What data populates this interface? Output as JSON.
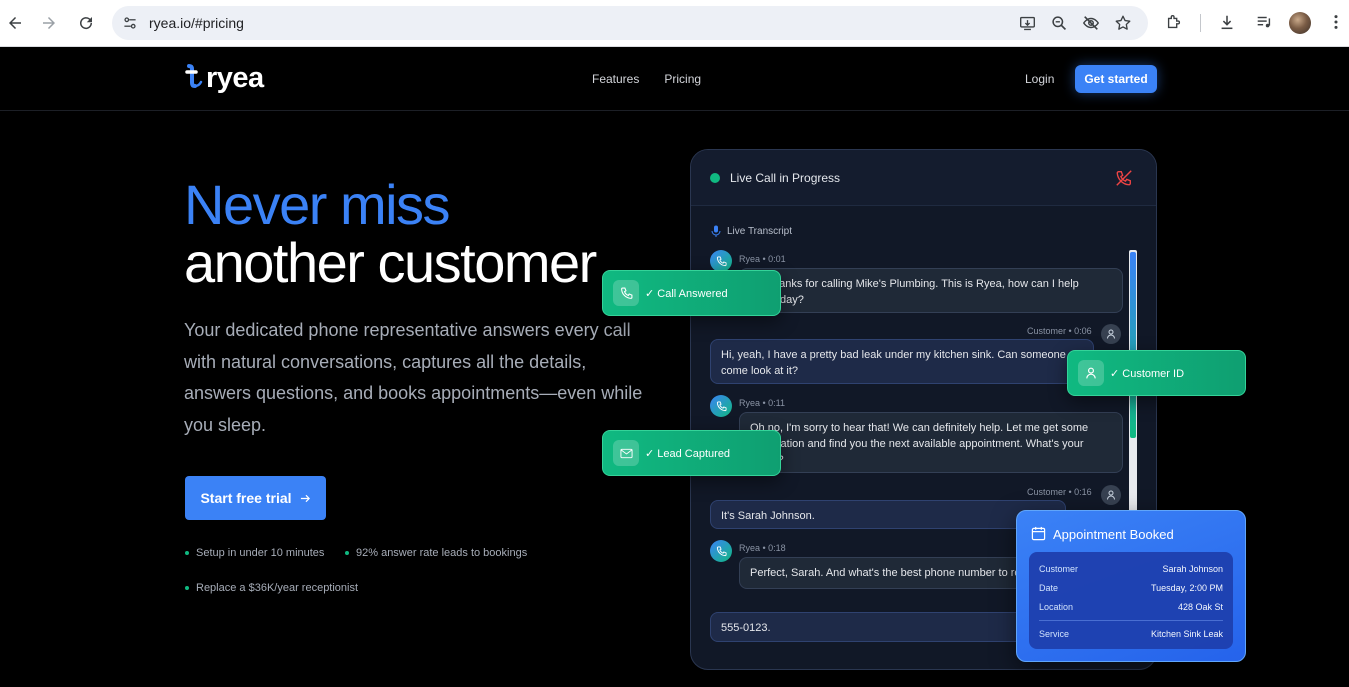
{
  "browser": {
    "url": "ryea.io/#pricing"
  },
  "site": {
    "logo": "ryea",
    "nav": [
      "Features",
      "Pricing"
    ],
    "login": "Login",
    "get_started": "Get started"
  },
  "hero": {
    "headline_line1": "Never miss",
    "headline_line2": "another customer",
    "subtext": "Your dedicated phone representative answers every call with natural conversations, captures all the details, answers questions, and books appointments—even while you sleep.",
    "cta": "Start free trial",
    "bullets": [
      "Setup in under 10 minutes",
      "92% answer rate leads to bookings",
      "Replace a $36K/year receptionist"
    ]
  },
  "call": {
    "status": "Live Call in Progress",
    "transcript_label": "Live Transcript",
    "messages": [
      {
        "speaker": "Ryea",
        "time": "0:01",
        "meta": "Ryea • 0:01",
        "text_l1": "Hi! Thanks for calling Mike's Plumbing. This is Ryea, how can I help",
        "text_l2": "you today?"
      },
      {
        "speaker": "Customer",
        "time": "0:06",
        "meta": "Customer • 0:06",
        "text_l1": "Hi, yeah, I have a pretty bad leak under my kitchen sink. Can someone",
        "text_l2": "come look at it?"
      },
      {
        "speaker": "Ryea",
        "time": "0:11",
        "meta": "Ryea • 0:11",
        "text_l1": "Oh no, I'm sorry to hear that! We can definitely help. Let me get some",
        "text_l2": "information and find you the next available appointment. What's your",
        "text_l3": "name?"
      },
      {
        "speaker": "Customer",
        "time": "0:16",
        "meta": "Customer • 0:16",
        "text_l1": "It's Sarah Johnson."
      },
      {
        "speaker": "Ryea",
        "time": "0:18",
        "meta": "Ryea • 0:18",
        "text_l1": "Perfect, Sarah. And what's the best phone number to reach you?"
      },
      {
        "speaker": "Customer",
        "text_l1": "555-0123."
      }
    ]
  },
  "badges": {
    "call_answered": "✓ Call Answered",
    "customer_id": "✓ Customer ID",
    "lead_captured": "✓ Lead Captured"
  },
  "appointment": {
    "title": "Appointment Booked",
    "rows": [
      {
        "label": "Customer",
        "value": "Sarah Johnson"
      },
      {
        "label": "Date",
        "value": "Tuesday, 2:00 PM"
      },
      {
        "label": "Location",
        "value": "428 Oak St"
      },
      {
        "label": "Service",
        "value": "Kitchen Sink Leak"
      }
    ]
  },
  "colors": {
    "accent_blue": "#3b82f6",
    "accent_green": "#10b981",
    "background": "#000000"
  }
}
